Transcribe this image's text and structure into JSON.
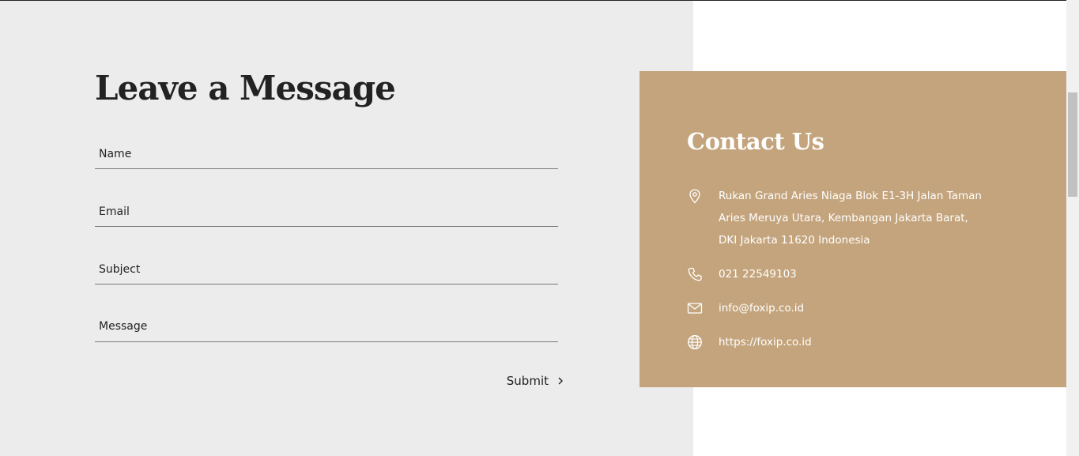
{
  "form": {
    "title": "Leave a Message",
    "name_placeholder": "Name",
    "email_placeholder": "Email",
    "subject_placeholder": "Subject",
    "message_placeholder": "Message",
    "submit_label": "Submit"
  },
  "contact": {
    "title": "Contact Us",
    "address_line1": "Rukan Grand Aries Niaga Blok E1-3H Jalan Taman",
    "address_line2": "Aries Meruya Utara, Kembangan Jakarta Barat,",
    "address_line3": "DKI Jakarta 11620 Indonesia",
    "phone": "021 22549103",
    "email": "info@foxip.co.id",
    "website": "https://foxip.co.id",
    "icons": [
      "location-pin-icon",
      "phone-icon",
      "mail-icon",
      "globe-icon"
    ]
  },
  "colors": {
    "panel_background": "#ececec",
    "contact_card": "#c4a47c",
    "text_dark": "#222222",
    "text_light": "#ffffff"
  }
}
